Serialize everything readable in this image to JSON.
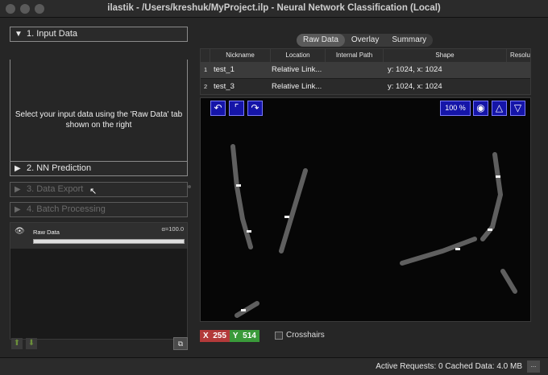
{
  "window": {
    "title": "ilastik - /Users/kreshuk/MyProject.ilp - Neural Network Classification (Local)"
  },
  "applets": [
    {
      "label": "1. Input Data",
      "expanded": true,
      "enabled": true
    },
    {
      "label": "2. NN Prediction",
      "expanded": false,
      "enabled": true
    },
    {
      "label": "3. Data Export",
      "expanded": false,
      "enabled": false
    },
    {
      "label": "4. Batch Processing",
      "expanded": false,
      "enabled": false
    }
  ],
  "input_hint": "Select your input data using the 'Raw Data' tab shown on the right",
  "layer": {
    "name": "Raw Data",
    "alpha": "α=100.0",
    "opacity": 1.0
  },
  "tabs": [
    "Raw Data",
    "Overlay",
    "Summary"
  ],
  "active_tab": "Raw Data",
  "table": {
    "headers": [
      "Nickname",
      "Location",
      "Internal Path",
      "Shape",
      "Resolu"
    ],
    "rows": [
      {
        "num": "1",
        "nickname": "test_1",
        "location": "Relative Link...",
        "internal_path": "",
        "shape": "y: 1024, x: 1024"
      },
      {
        "num": "2",
        "nickname": "test_3",
        "location": "Relative Link...",
        "internal_path": "",
        "shape": "y: 1024, x: 1024"
      }
    ]
  },
  "viewer": {
    "zoom": "100 %",
    "x_label": "X",
    "x_value": "255",
    "y_label": "Y",
    "y_value": "514",
    "crosshairs_label": "Crosshairs"
  },
  "status": {
    "text": "Active Requests: 0  Cached Data: 4.0 MB",
    "button_label": "..."
  },
  "colors": {
    "viewer_button": "#1515a8",
    "x_badge": "#b33a3a",
    "y_badge": "#3a9a3a"
  }
}
